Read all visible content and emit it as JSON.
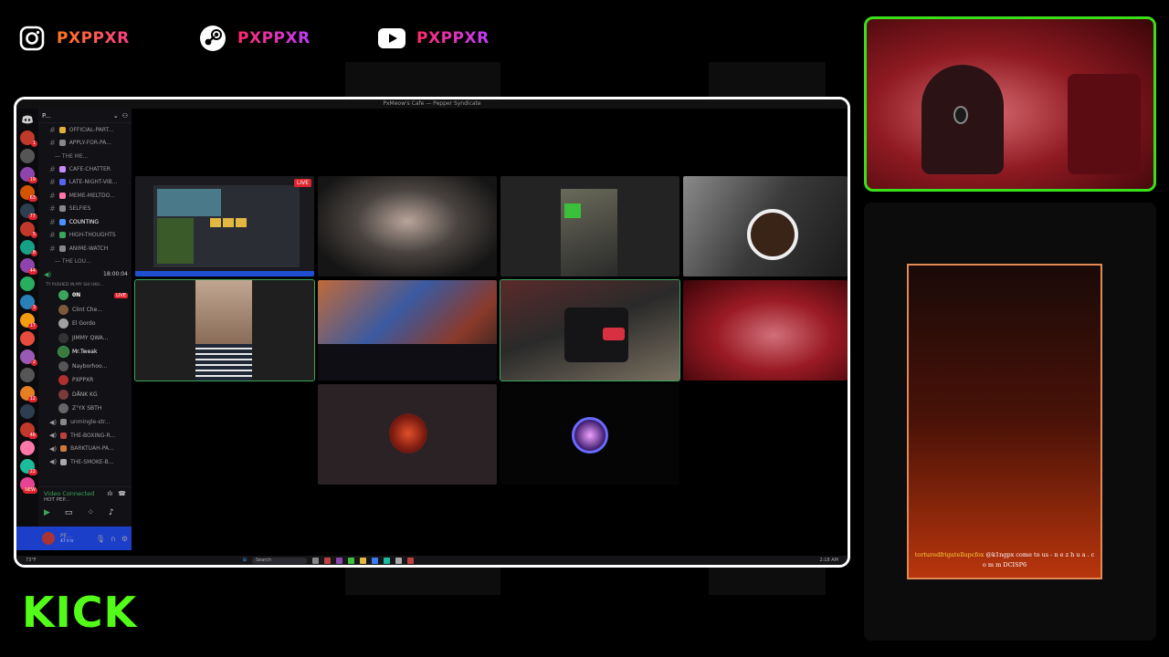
{
  "socials": [
    {
      "platform_icon": "instagram-icon",
      "handle": "PXPPXR"
    },
    {
      "platform_icon": "steam-icon",
      "handle": "PXPPXR"
    },
    {
      "platform_icon": "youtube-icon",
      "handle": "PXPPXR"
    }
  ],
  "discord": {
    "window_title": "PxMeow's Cafe — Pepper Syndicate",
    "server_name": "P...",
    "channels": [
      {
        "name": "OFFICIAL-PART...",
        "color": "#e0b03a"
      },
      {
        "name": "APPLY-FOR-PA...",
        "color": "#888888"
      }
    ],
    "category_1": "— THE ME...",
    "channels_2": [
      {
        "name": "CAFE-CHATTER",
        "color": "#c98aff"
      },
      {
        "name": "LATE-NIGHT-VIB...",
        "color": "#5865f2"
      },
      {
        "name": "MEME-MELTDO...",
        "color": "#ff77aa"
      },
      {
        "name": "SELFIES",
        "color": "#888888"
      },
      {
        "name": "COUNTING",
        "color": "#4a90ff"
      },
      {
        "name": "HIGH-THOUGHTS",
        "color": "#3ba55d"
      },
      {
        "name": "ANIME-WATCH",
        "color": "#888888"
      }
    ],
    "category_2": "— THE LOU...",
    "voice_channel_status": "18:00:04",
    "voice_subtitle": "TY PUSHED IN MY SHI UKU...",
    "voice_users": [
      {
        "name": "0N",
        "live": "LIVE",
        "color": "#3ba55d"
      },
      {
        "name": "Clint Che...",
        "live": "",
        "color": "#7a5a3a"
      },
      {
        "name": "El Gordo",
        "live": "",
        "color": "#a0a0a0"
      },
      {
        "name": "JIMMY QWA...",
        "live": "",
        "color": "#333333"
      },
      {
        "name": "Mr.Tweak",
        "live": "",
        "color": "#3a7a3a"
      },
      {
        "name": "Nayborhoo...",
        "live": "",
        "color": "#555555"
      },
      {
        "name": "PXPPXR",
        "live": "",
        "color": "#b03030"
      },
      {
        "name": "DÅNK  KG",
        "live": "",
        "color": "#7a3a3a"
      },
      {
        "name": "Z⁷YX  SBTH",
        "live": "",
        "color": "#666666"
      }
    ],
    "channels_3": [
      {
        "name": "unmingle-str...",
        "color": "#888888"
      },
      {
        "name": "THE-BOXING-R...",
        "color": "#c04040"
      },
      {
        "name": "BARKTUAH-PA...",
        "color": "#d07a3a"
      },
      {
        "name": "THE-SMOKE-B...",
        "color": "#aaaaaa"
      }
    ],
    "voice_connected_label": "Video Connected",
    "voice_connected_sub": "HOT PEP...",
    "user_name": "PE...",
    "user_status": "47 ll tr",
    "stream_tiles": [
      {
        "kind": "screen",
        "live": "LIVE"
      },
      {
        "kind": "cam-grey"
      },
      {
        "kind": "cam-hand"
      },
      {
        "kind": "cam-dark"
      },
      {
        "kind": "cam-person"
      },
      {
        "kind": "cam-poster"
      },
      {
        "kind": "cam-room"
      },
      {
        "kind": "cam-red"
      },
      {
        "kind": "avatar-pepper"
      },
      {
        "kind": "avatar-ring"
      }
    ],
    "taskbar": {
      "search_label": "Search",
      "clock": "2:18 AM",
      "weather": "73°F"
    }
  },
  "alert": {
    "username": "torturedfrigatellupcfox",
    "message": "@k1ngpx come to us - n e z h u a . c o m m DCISP6"
  },
  "kick_logo": "KICK",
  "colors": {
    "accent_green": "#53fc18",
    "cam_border": "#38e01a",
    "discord_blue": "#1b3fc8"
  }
}
